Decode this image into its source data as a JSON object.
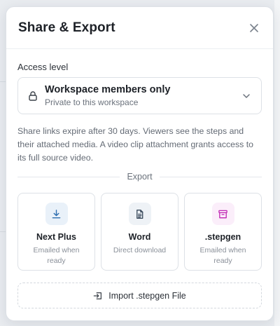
{
  "modal": {
    "title": "Share & Export",
    "close_icon": "close-icon"
  },
  "access": {
    "label": "Access level",
    "selected_value": "Workspace members only",
    "selected_sub": "Private to this workspace",
    "icon": "lock-icon"
  },
  "description": "Share links expire after 30 days. Viewers see the steps and their attached media. A video clip attachment grants access to its full source video.",
  "export": {
    "divider_label": "Export",
    "options": [
      {
        "title": "Next Plus",
        "subtitle": "Emailed when ready",
        "icon": "download-icon",
        "accent": "#2f6fb0",
        "bg": "#e9f1f9"
      },
      {
        "title": "Word",
        "subtitle": "Direct download",
        "icon": "document-icon",
        "accent": "#3a4a5c",
        "bg": "#eef2f6"
      },
      {
        "title": ".stepgen",
        "subtitle": "Emailed when ready",
        "icon": "archive-icon",
        "accent": "#c026b3",
        "bg": "#fbeefa"
      }
    ]
  },
  "import": {
    "label": "Import .stepgen File",
    "icon": "import-icon"
  }
}
